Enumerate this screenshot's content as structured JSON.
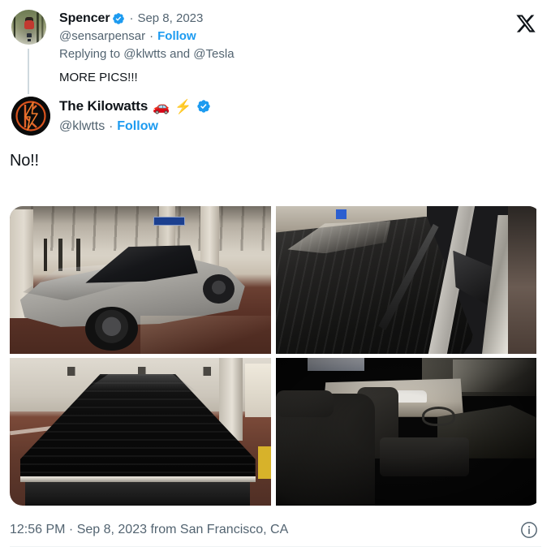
{
  "platform": {
    "name": "X",
    "logo_icon": "x-logo-icon",
    "accent_color": "#1d9bf0",
    "text_primary": "#0f1419",
    "text_secondary": "#536471",
    "verified_color": "#1d9bf0"
  },
  "parent_tweet": {
    "avatar_name": "spencer-avatar",
    "display_name": "Spencer",
    "verified": true,
    "verified_icon": "verified-badge-icon",
    "separator": "·",
    "date": "Sep 8, 2023",
    "handle": "@sensarpensar",
    "follow_label": "Follow",
    "replying_to": "Replying to @klwtts and @Tesla",
    "text": "MORE PICS!!!"
  },
  "main_tweet": {
    "avatar_name": "kilowatts-avatar",
    "display_name": "The Kilowatts",
    "emoji_car": "🚗",
    "emoji_bolt": "⚡",
    "verified": true,
    "verified_icon": "verified-badge-icon",
    "handle": "@klwtts",
    "separator": "·",
    "follow_label": "Follow",
    "text": "No!!"
  },
  "media": {
    "layout": "2x2-grid",
    "count": 4,
    "items": [
      {
        "position": "top-left",
        "alt": "Tesla Cybertruck parked in a concrete parking garage, silver stainless steel body, front three-quarter view"
      },
      {
        "position": "top-right",
        "alt": "Close-up of Cybertruck windshield, wiper blade, stainless A-pillar and side mirror"
      },
      {
        "position": "bottom-left",
        "alt": "Black tonneau bed cover of the Cybertruck seen from the rear tailgate"
      },
      {
        "position": "bottom-right",
        "alt": "Cybertruck interior showing front seats, center console, steering yoke and dashboard"
      }
    ]
  },
  "footer": {
    "time": "12:56 PM",
    "separator": "·",
    "date": "Sep 8, 2023",
    "location_prefix": "from",
    "location": "San Francisco, CA",
    "meta_line": "12:56 PM · Sep 8, 2023 from San Francisco, CA",
    "info_icon": "info-circle-icon"
  }
}
